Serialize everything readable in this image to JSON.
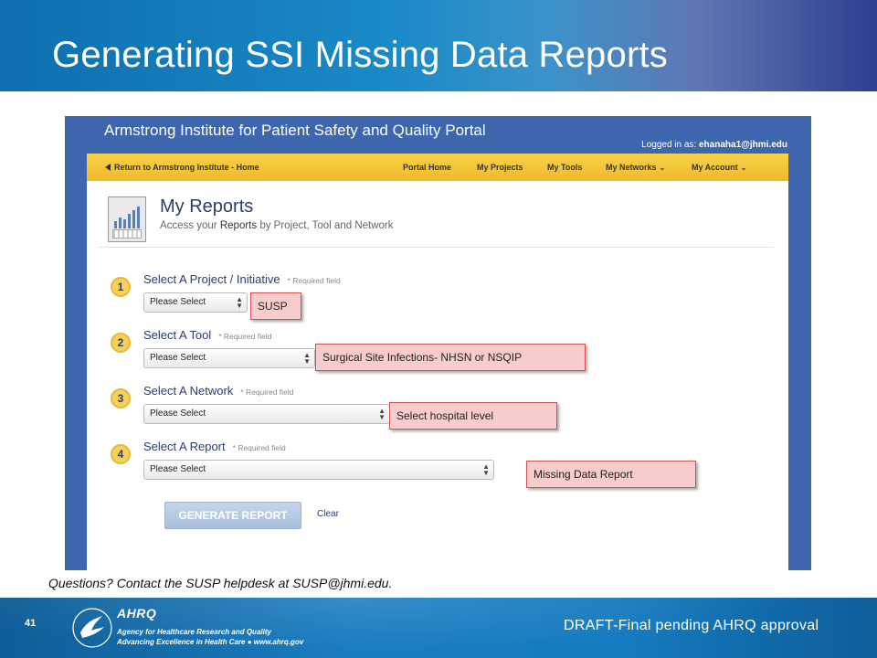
{
  "slide": {
    "title": "Generating SSI Missing Data Reports",
    "questions": "Questions? Contact the SUSP helpdesk at SUSP@jhmi.edu.",
    "page_number": "41",
    "draft_note": "DRAFT-Final pending AHRQ approval"
  },
  "portal": {
    "title": "Armstrong Institute for Patient Safety and Quality Portal",
    "logged_in_prefix": "Logged in as:",
    "logged_in_user": "ehanaha1@jhmi.edu",
    "nav": {
      "back": "Return to Armstrong Institute - Home",
      "home": "Portal Home",
      "projects": "My Projects",
      "tools": "My Tools",
      "networks": "My Networks",
      "account": "My Account"
    },
    "page_title": "My Reports",
    "subtitle_prefix": "Access your",
    "subtitle_highlight": "Reports",
    "subtitle_suffix": "by Project, Tool and Network",
    "required_text": "* Required field",
    "steps": [
      {
        "number": "1",
        "label": "Select A Project / Initiative",
        "value": "Please Select"
      },
      {
        "number": "2",
        "label": "Select A Tool",
        "value": "Please Select"
      },
      {
        "number": "3",
        "label": "Select A Network",
        "value": "Please Select"
      },
      {
        "number": "4",
        "label": "Select A Report",
        "value": "Please Select"
      }
    ],
    "generate_label": "GENERATE REPORT",
    "clear_label": "Clear"
  },
  "callouts": {
    "project": "SUSP",
    "tool": "Surgical Site Infections- NHSN or NSQIP",
    "network": "Select hospital level",
    "report": "Missing Data Report"
  },
  "footer": {
    "ahrq": "AHRQ",
    "agency": "Agency for Healthcare Research and Quality",
    "tagline": "Advancing Excellence in Health Care ● www.ahrq.gov"
  },
  "icons": {
    "back": "left-triangle-icon",
    "dropdown": "chevron-down-icon",
    "select": "up-down-arrows-icon",
    "report": "report-chart-icon",
    "hhs": "hhs-eagle-logo"
  },
  "colors": {
    "portal_blue": "#3e66ad",
    "nav_yellow": "#f1b92a",
    "callout_fill": "#f6cccc",
    "callout_border": "#d05050"
  }
}
